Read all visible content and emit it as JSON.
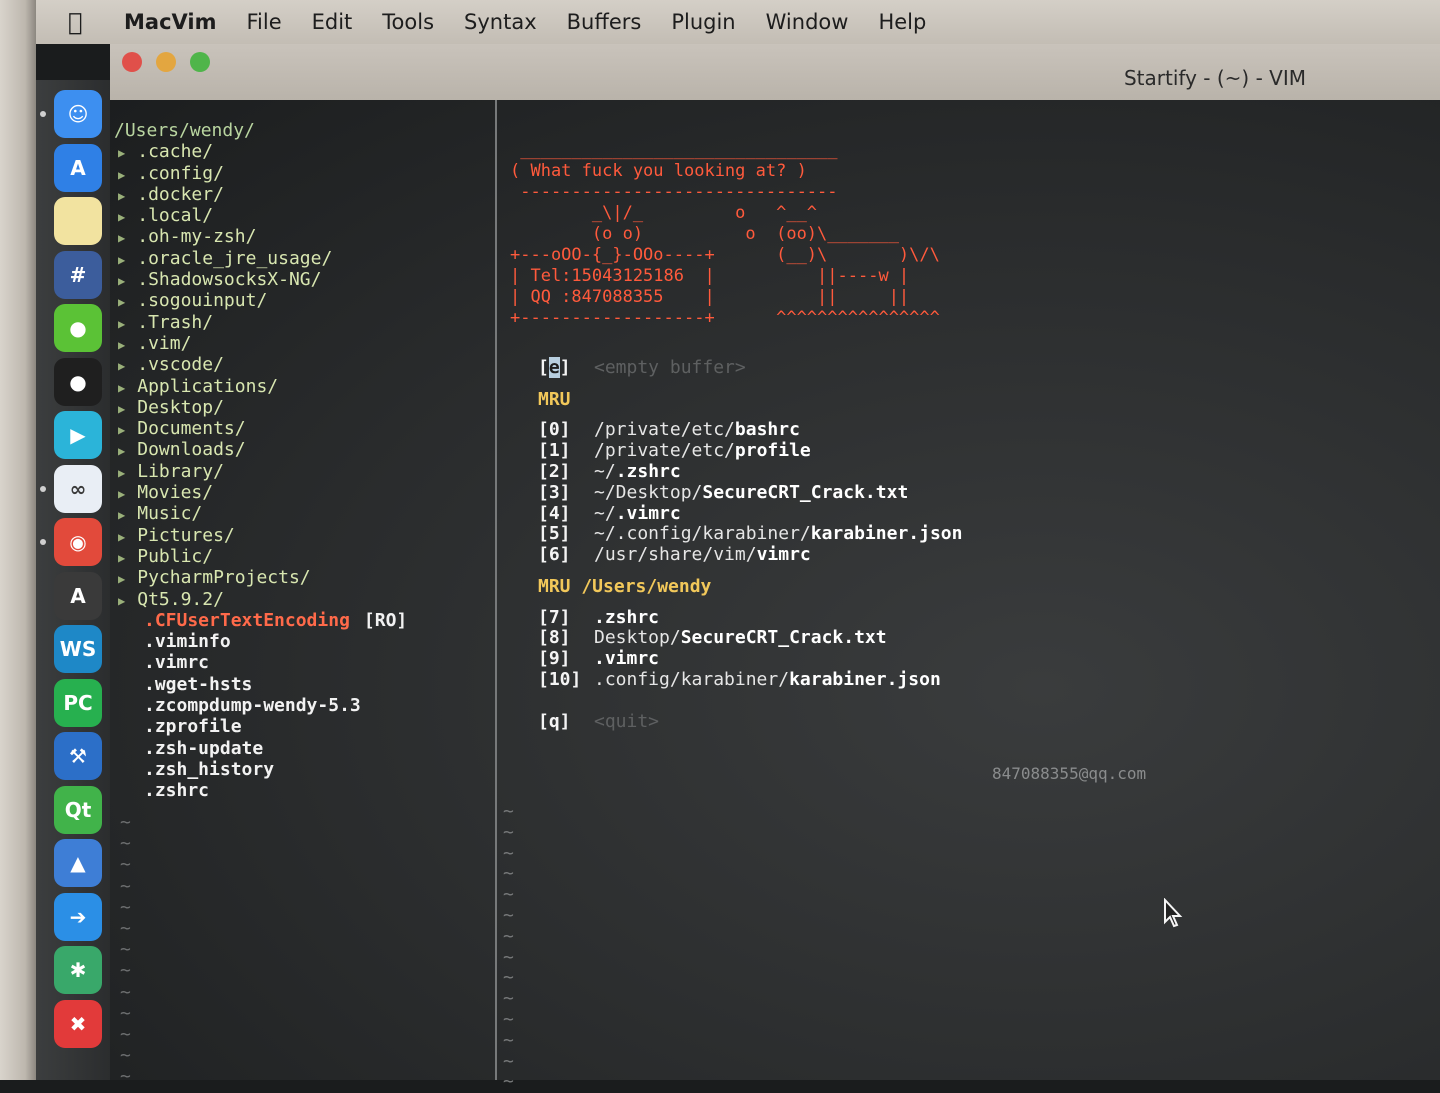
{
  "menubar": {
    "app_name": "MacVim",
    "items": [
      "File",
      "Edit",
      "Tools",
      "Syntax",
      "Buffers",
      "Plugin",
      "Window",
      "Help"
    ]
  },
  "window": {
    "title": "Startify - (~) - VIM"
  },
  "dock": {
    "apps": [
      {
        "name": "finder-icon",
        "glyph": "☺",
        "color": "#3d8ff0"
      },
      {
        "name": "app-store-icon",
        "glyph": "A",
        "color": "#2f80e6"
      },
      {
        "name": "notes-icon",
        "glyph": "",
        "color": "#f2e3a0"
      },
      {
        "name": "bird-app-icon",
        "glyph": "#",
        "color": "#3c5d9c"
      },
      {
        "name": "wechat-icon",
        "glyph": "●",
        "color": "#5bc236"
      },
      {
        "name": "qq-icon",
        "glyph": "●",
        "color": "#1f1f1f"
      },
      {
        "name": "media-player-icon",
        "glyph": "▶",
        "color": "#2bb4d9"
      },
      {
        "name": "baidu-netdisk-icon",
        "glyph": "∞",
        "color": "#e9eef5"
      },
      {
        "name": "chrome-icon",
        "glyph": "◉",
        "color": "#e24a3b"
      },
      {
        "name": "sublime-icon",
        "glyph": "A",
        "color": "#3a3a3a"
      },
      {
        "name": "webstorm-icon",
        "glyph": "WS",
        "color": "#1e88c7"
      },
      {
        "name": "pycharm-icon",
        "glyph": "PC",
        "color": "#27b04f"
      },
      {
        "name": "xcode-icon",
        "glyph": "⚒",
        "color": "#2c6fc8"
      },
      {
        "name": "qt-creator-icon",
        "glyph": "Qt",
        "color": "#41b34a"
      },
      {
        "name": "utility-icon",
        "glyph": "▲",
        "color": "#3e7ed6"
      },
      {
        "name": "migration-icon",
        "glyph": "➔",
        "color": "#2b8fe6"
      },
      {
        "name": "mindnode-icon",
        "glyph": "✱",
        "color": "#39a86a"
      },
      {
        "name": "xmind-icon",
        "glyph": "✖",
        "color": "#e23a3a"
      }
    ]
  },
  "nerdtree": {
    "root": "/Users/wendy/",
    "dirs": [
      ".cache/",
      ".config/",
      ".docker/",
      ".local/",
      ".oh-my-zsh/",
      ".oracle_jre_usage/",
      ".ShadowsocksX-NG/",
      ".sogouinput/",
      ".Trash/",
      ".vim/",
      ".vscode/",
      "Applications/",
      "Desktop/",
      "Documents/",
      "Downloads/",
      "Library/",
      "Movies/",
      "Music/",
      "Pictures/",
      "Public/",
      "PycharmProjects/",
      "Qt5.9.2/"
    ],
    "highlighted_file": ".CFUserTextEncoding",
    "highlighted_flag": "[RO]",
    "files": [
      ".viminfo",
      ".vimrc",
      ".wget-hsts",
      ".zcompdump-wendy-5.3",
      ".zprofile",
      ".zsh-update",
      ".zsh_history",
      ".zshrc"
    ],
    "tildes": "~\n~\n~\n~\n~\n~\n~\n~\n~\n~\n~\n~\n~"
  },
  "startify": {
    "header_art": " _______________________________\n( What fuck you looking at? )\n -------------------------------\n        _\\|/_         o   ^__^\n        (o o)          o  (oo)\\_______\n+---oOO-{_}-OOo----+      (__)\\       )\\/\\\n| Tel:15043125186  |          ||----w |\n| QQ :847088355    |          ||     ||\n+------------------+      ^^^^^^^^^^^^^^^^",
    "empty_key_open": "[",
    "empty_key": "e",
    "empty_key_close": "]",
    "empty_label": "<empty buffer>",
    "mru_header": "MRU",
    "mru": [
      {
        "idx": "[0]",
        "dir": "/private/etc/",
        "file": "bashrc"
      },
      {
        "idx": "[1]",
        "dir": "/private/etc/",
        "file": "profile"
      },
      {
        "idx": "[2]",
        "dir": "~/",
        "file": ".zshrc"
      },
      {
        "idx": "[3]",
        "dir": "~/Desktop/",
        "file": "SecureCRT_Crack.txt"
      },
      {
        "idx": "[4]",
        "dir": "~/",
        "file": ".vimrc"
      },
      {
        "idx": "[5]",
        "dir": "~/.config/karabiner/",
        "file": "karabiner.json"
      },
      {
        "idx": "[6]",
        "dir": "/usr/share/vim/",
        "file": "vimrc"
      }
    ],
    "mru_dir_header": "MRU /Users/wendy",
    "mru_dir": [
      {
        "idx": "[7]",
        "dir": "",
        "file": ".zshrc"
      },
      {
        "idx": "[8]",
        "dir": "Desktop/",
        "file": "SecureCRT_Crack.txt"
      },
      {
        "idx": "[9]",
        "dir": "",
        "file": ".vimrc"
      },
      {
        "idx": "[10]",
        "dir": ".config/karabiner/",
        "file": "karabiner.json"
      }
    ],
    "quit_key": "[q]",
    "quit_label": "<quit>",
    "footer_email": "847088355@qq.com",
    "tildes": "~\n~\n~\n~\n~\n~\n~\n~\n~\n~\n~\n~\n~\n~"
  }
}
